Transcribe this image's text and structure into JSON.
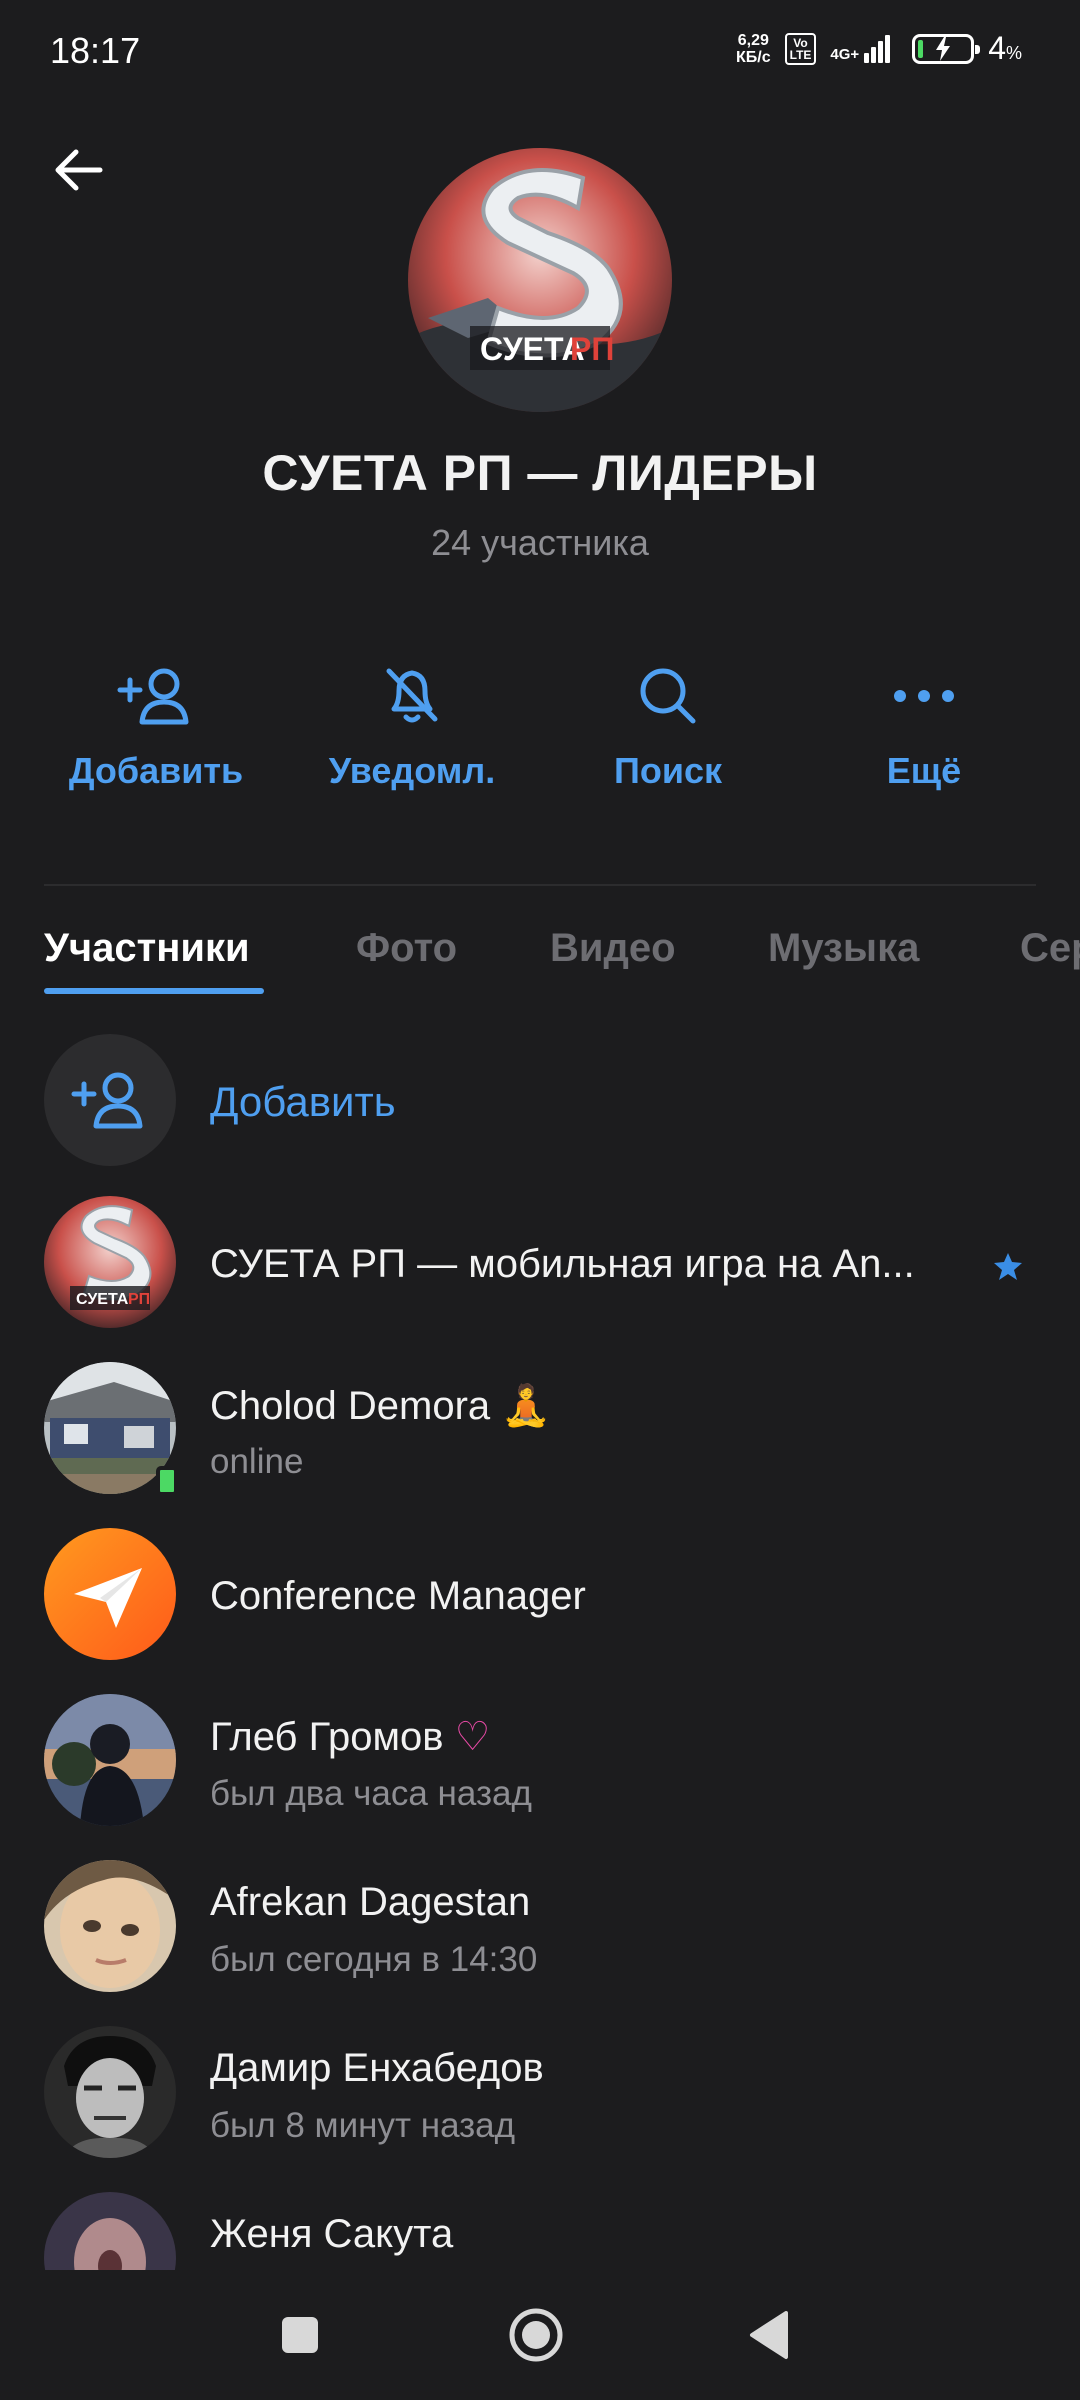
{
  "status_bar": {
    "time": "18:17",
    "net_speed_value": "6,29",
    "net_speed_unit": "КБ/с",
    "volte_top": "Vo",
    "volte_bottom": "LTE",
    "network": "4G+",
    "battery_percent": "4",
    "battery_percent_sign": "%"
  },
  "header": {
    "title": "СУЕТА РП — ЛИДЕРЫ",
    "subtitle": "24 участника",
    "avatar_text": "СУЕТА",
    "avatar_text_accent": "РП"
  },
  "actions": [
    {
      "label": "Добавить",
      "icon": "add-user-icon"
    },
    {
      "label": "Уведомл.",
      "icon": "bell-off-icon"
    },
    {
      "label": "Поиск",
      "icon": "search-icon"
    },
    {
      "label": "Ещё",
      "icon": "more-icon"
    }
  ],
  "tabs": [
    "Участники",
    "Фото",
    "Видео",
    "Музыка",
    "Сер"
  ],
  "active_tab": "Участники",
  "add_member_label": "Добавить",
  "members": [
    {
      "name": "СУЕТА РП — мобильная игра на An...",
      "status": "",
      "badge": "star-icon"
    },
    {
      "name": "Cholod Demora",
      "emoji": "🧘",
      "status": "online"
    },
    {
      "name": "Conference Manager",
      "status": ""
    },
    {
      "name": "Глеб Громов",
      "emoji": "♡",
      "status": "был два часа назад"
    },
    {
      "name": "Afrekan Dagestan",
      "status": "был сегодня в 14:30"
    },
    {
      "name": "Дамир Енхабедов",
      "status": "был 8 минут назад"
    },
    {
      "name": "Женя Сакута",
      "status": ""
    }
  ],
  "colors": {
    "background": "#1c1c1e",
    "accent": "#4f9ff0",
    "online": "#4cd964",
    "secondary_text": "#8e8e93"
  }
}
